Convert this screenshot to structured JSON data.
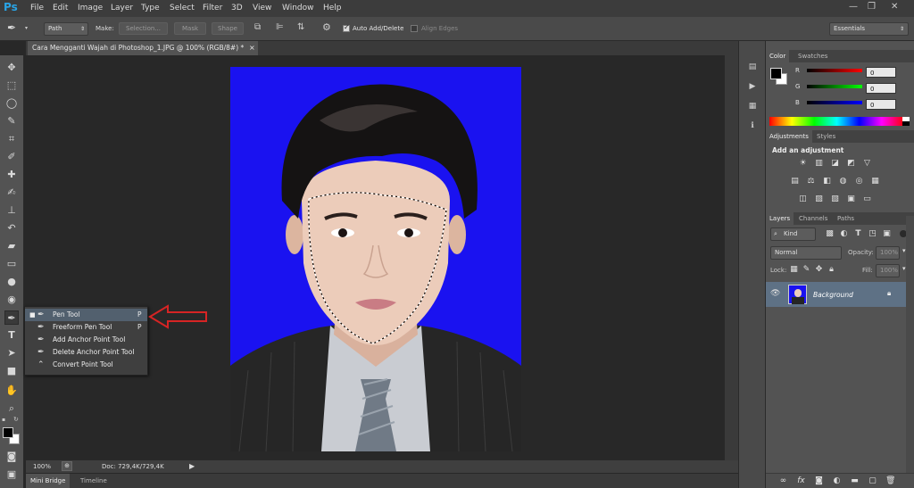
{
  "app": {
    "logo": "Ps"
  },
  "menu": [
    "File",
    "Edit",
    "Image",
    "Layer",
    "Type",
    "Select",
    "Filter",
    "3D",
    "View",
    "Window",
    "Help"
  ],
  "window_controls": {
    "minimize": "—",
    "restore": "❐",
    "close": "✕"
  },
  "options": {
    "mode_value": "Path",
    "make_label": "Make:",
    "selection_btn": "Selection...",
    "mask_btn": "Mask",
    "shape_btn": "Shape",
    "auto_add_label": "Auto Add/Delete",
    "align_edges_label": "Align Edges",
    "workspace_value": "Essentials"
  },
  "document": {
    "tab_title": "Cara Mengganti Wajah di Photoshop_1.JPG @ 100% (RGB/8#) *",
    "close_glyph": "×"
  },
  "status": {
    "zoom": "100%",
    "doc_info": "Doc: 729,4K/729,4K"
  },
  "bottom_tabs": [
    "Mini Bridge",
    "Timeline"
  ],
  "tool_flyout": {
    "items": [
      {
        "label": "Pen Tool",
        "key": "P",
        "selected": true
      },
      {
        "label": "Freeform Pen Tool",
        "key": "P",
        "selected": false
      },
      {
        "label": "Add Anchor Point Tool",
        "key": "",
        "selected": false
      },
      {
        "label": "Delete Anchor Point Tool",
        "key": "",
        "selected": false
      },
      {
        "label": "Convert Point Tool",
        "key": "",
        "selected": false
      }
    ],
    "bullet": "■"
  },
  "color_panel": {
    "tabs": [
      "Color",
      "Swatches"
    ],
    "channels": [
      {
        "label": "R",
        "value": "0"
      },
      {
        "label": "G",
        "value": "0"
      },
      {
        "label": "B",
        "value": "0"
      }
    ]
  },
  "adjustments_panel": {
    "tabs": [
      "Adjustments",
      "Styles"
    ],
    "heading": "Add an adjustment"
  },
  "layers_panel": {
    "tabs": [
      "Layers",
      "Channels",
      "Paths"
    ],
    "filter_value": "Kind",
    "blend_mode": "Normal",
    "opacity_label": "Opacity:",
    "opacity_value": "100%",
    "lock_label": "Lock:",
    "fill_label": "Fill:",
    "fill_value": "100%",
    "layers": [
      {
        "name": "Background"
      }
    ]
  },
  "colors": {
    "chrome": "#535353",
    "canvas_bg": "#282828",
    "photo_bg": "#1a12f0",
    "selected_row": "#52606e",
    "arrow": "#d62424",
    "logo": "#29a4e6"
  }
}
